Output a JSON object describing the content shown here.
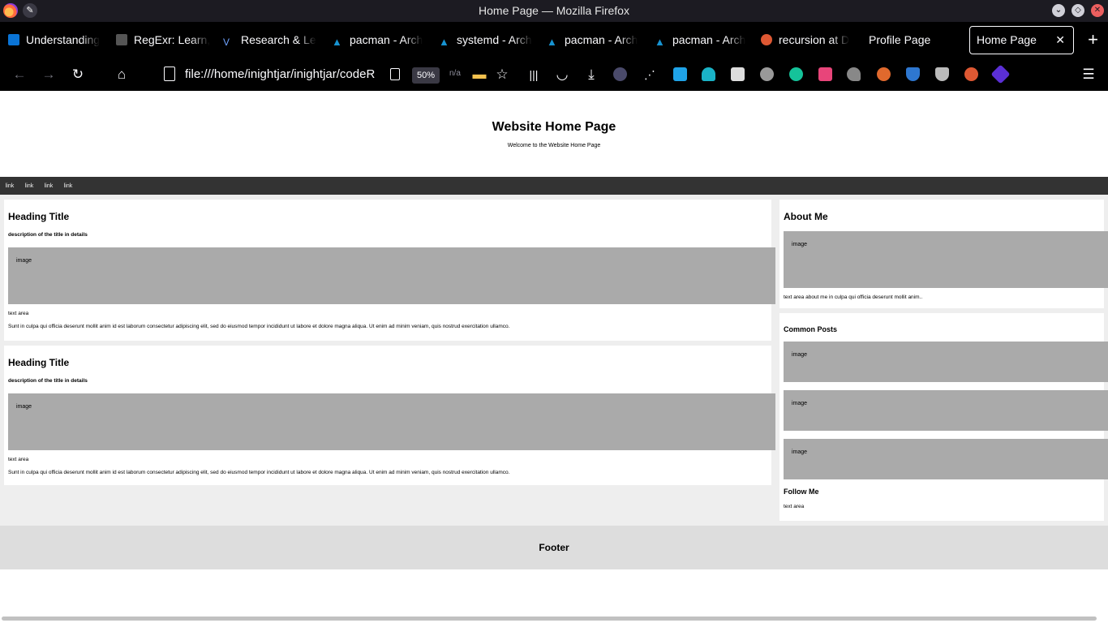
{
  "window": {
    "title": "Home Page — Mozilla Firefox"
  },
  "tabs": [
    {
      "label": "Understanding"
    },
    {
      "label": "RegExr: Learn,"
    },
    {
      "label": "Research & Le"
    },
    {
      "label": "pacman - Arch"
    },
    {
      "label": "systemd - Arch"
    },
    {
      "label": "pacman - Arch"
    },
    {
      "label": "pacman - Arch"
    },
    {
      "label": "recursion at D"
    },
    {
      "label": "Profile Page"
    },
    {
      "label": "Home Page"
    }
  ],
  "toolbar": {
    "url": "file:///home/inightjar/inightjar/codeR",
    "zoom": "50%",
    "na": "n/a"
  },
  "site": {
    "header_title": "Website Home Page",
    "header_subtitle": "Welcome to the Website Home Page",
    "nav_links": [
      "link",
      "link",
      "link",
      "link"
    ],
    "posts": [
      {
        "title": "Heading Title",
        "description": "description of the title in details",
        "image_label": "image",
        "text_label": "text area",
        "body": "Sunt in culpa qui officia deserunt mollit anim id est laborum consectetur adipiscing elit, sed do eiusmod tempor incididunt ut labore et dolore magna aliqua. Ut enim ad minim veniam, quis nostrud exercitation ullamco."
      },
      {
        "title": "Heading Title",
        "description": "description of the title in details",
        "image_label": "image",
        "text_label": "text area",
        "body": "Sunt in culpa qui officia deserunt mollit anim id est laborum consectetur adipiscing elit, sed do eiusmod tempor incididunt ut labore et dolore magna aliqua. Ut enim ad minim veniam, quis nostrud exercitation ullamco."
      }
    ],
    "about": {
      "title": "About Me",
      "image_label": "image",
      "text": "text area about me in culpa qui officia deserunt mollit anim.."
    },
    "common_posts": {
      "title": "Common Posts",
      "images": [
        "image",
        "image",
        "image"
      ]
    },
    "follow": {
      "title": "Follow Me",
      "text": "text area"
    },
    "footer": "Footer"
  },
  "icons": {
    "back": "arrow-left-icon",
    "forward": "arrow-right-icon",
    "reload": "reload-icon",
    "home": "home-icon",
    "menu": "hamburger-menu-icon"
  }
}
